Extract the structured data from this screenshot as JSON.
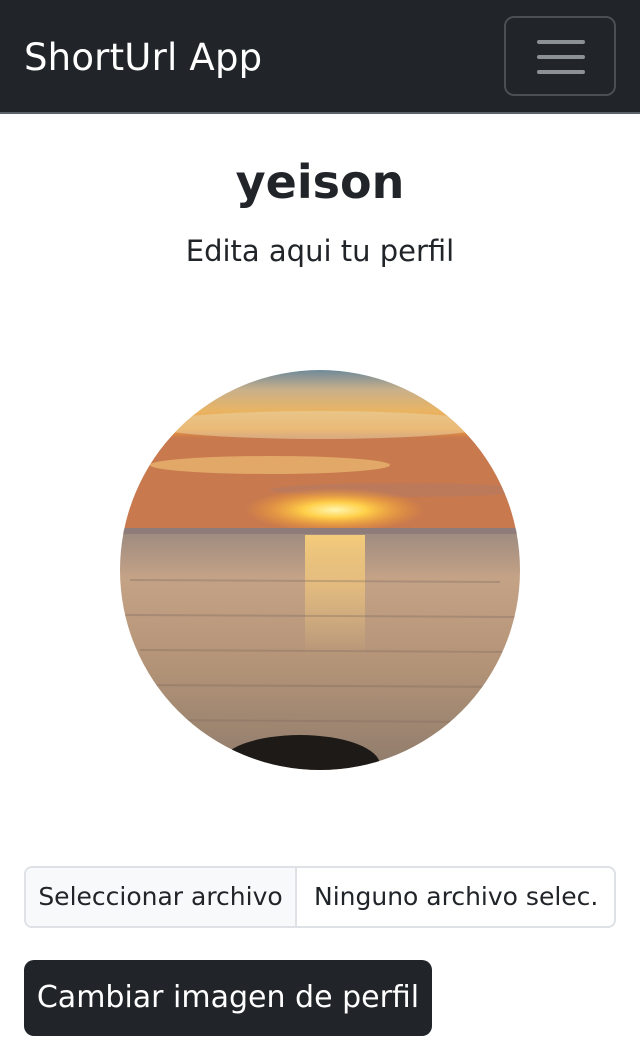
{
  "navbar": {
    "brand": "ShortUrl App",
    "toggler_icon": "hamburger-menu-icon"
  },
  "profile": {
    "username": "yeison",
    "subtitle": "Edita aqui tu perfil",
    "avatar": "sunset-over-sea-photo"
  },
  "upload": {
    "choose_label": "Seleccionar archivo",
    "file_status": "Ninguno archivo selec.",
    "submit_label": "Cambiar imagen de perfil"
  },
  "colors": {
    "navbar_bg": "#212529",
    "button_bg": "#212529",
    "text": "#212529",
    "border": "#dee2e6"
  }
}
